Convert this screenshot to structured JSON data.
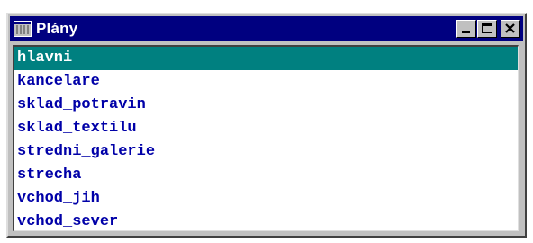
{
  "window": {
    "title": "Plány",
    "buttons": {
      "minimize": "minimize",
      "maximize": "maximize",
      "close": "close"
    }
  },
  "list": {
    "selected_index": 0,
    "items": [
      {
        "label": "hlavni"
      },
      {
        "label": "kancelare"
      },
      {
        "label": "sklad_potravin"
      },
      {
        "label": "sklad_textilu"
      },
      {
        "label": "stredni_galerie"
      },
      {
        "label": "strecha"
      },
      {
        "label": "vchod_jih"
      },
      {
        "label": "vchod_sever"
      }
    ]
  },
  "colors": {
    "titlebar": "#000080",
    "selection": "#008080",
    "item_text": "#0000a8"
  }
}
